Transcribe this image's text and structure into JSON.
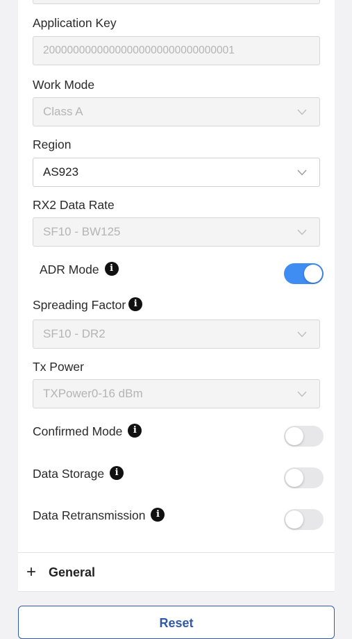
{
  "form": {
    "application_key": {
      "label": "Application Key",
      "value": "20000000000000000000000000000001"
    },
    "work_mode": {
      "label": "Work Mode",
      "value": "Class A"
    },
    "region": {
      "label": "Region",
      "value": "AS923"
    },
    "rx2_data_rate": {
      "label": "RX2 Data Rate",
      "value": "SF10 - BW125"
    },
    "adr_mode": {
      "label": "ADR Mode",
      "enabled": true
    },
    "spreading_factor": {
      "label": "Spreading Factor",
      "value": "SF10 - DR2"
    },
    "tx_power": {
      "label": "Tx Power",
      "value": "TXPower0-16 dBm"
    },
    "confirmed_mode": {
      "label": "Confirmed Mode",
      "enabled": false
    },
    "data_storage": {
      "label": "Data Storage",
      "enabled": false
    },
    "data_retransmission": {
      "label": "Data Retransmission",
      "enabled": false
    }
  },
  "sections": {
    "general": {
      "icon": "plus-icon",
      "label": "General"
    }
  },
  "actions": {
    "reset_label": "Reset"
  },
  "colors": {
    "accent": "#3f8cf2",
    "button_text": "#2f5aa8",
    "info_icon": "#111111"
  }
}
